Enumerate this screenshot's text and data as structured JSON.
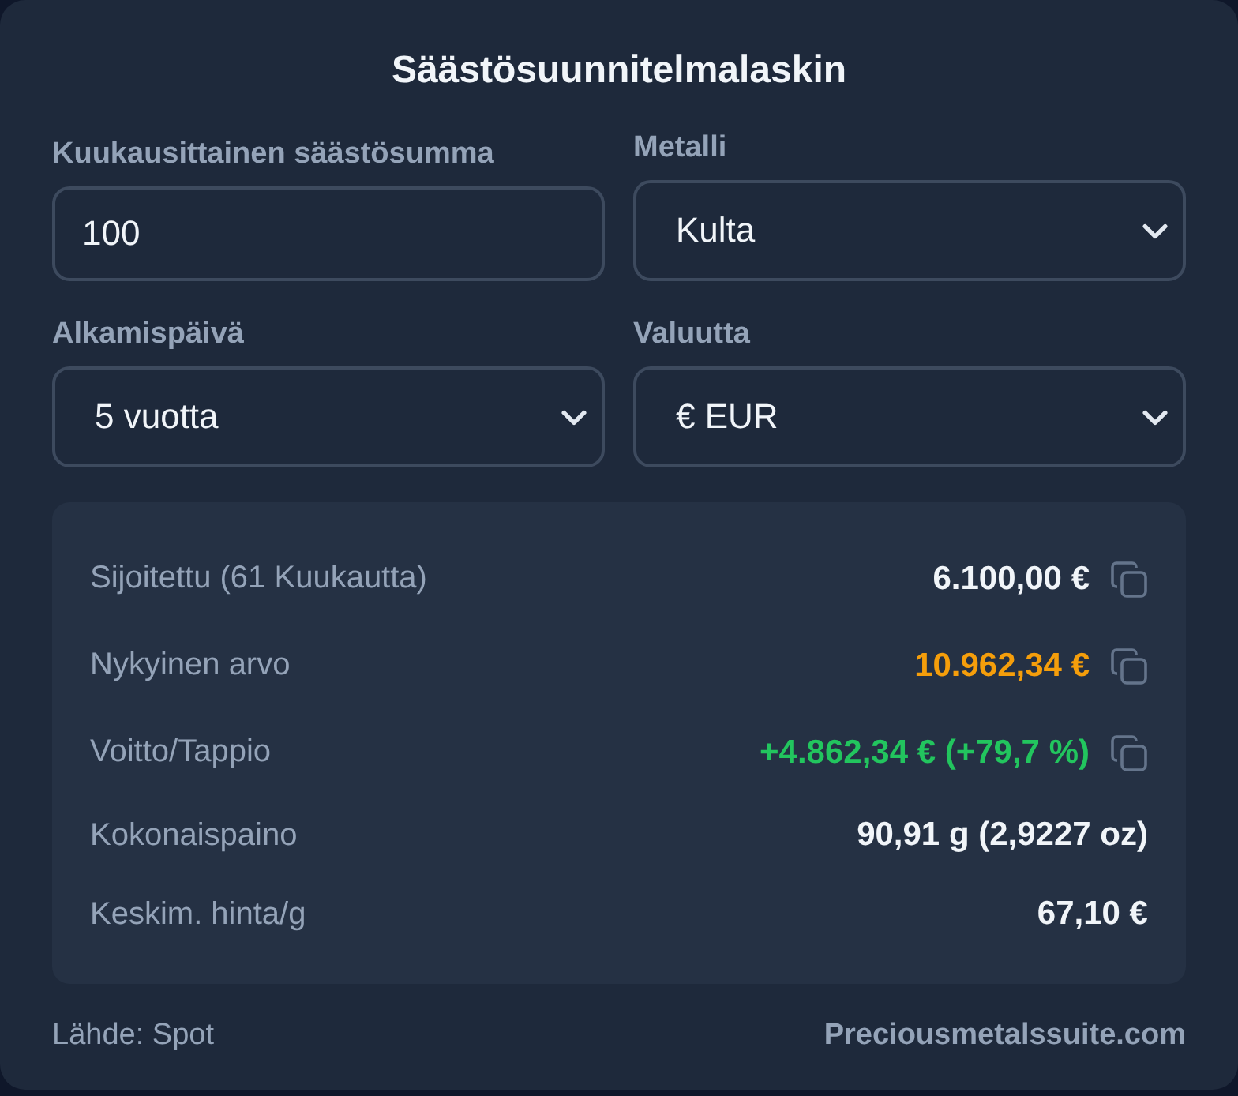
{
  "title": "Säästösuunnitelmalaskin",
  "fields": [
    {
      "kind": "input",
      "label": "Kuukausittainen säästösumma",
      "value": "100"
    },
    {
      "kind": "select",
      "label": "Metalli",
      "value": "Kulta"
    },
    {
      "kind": "select",
      "label": "Alkamispäivä",
      "value": "5 vuotta"
    },
    {
      "kind": "select",
      "label": "Valuutta",
      "value": "€ EUR"
    }
  ],
  "results": [
    {
      "label": "Sijoitettu (61 Kuukautta)",
      "value": "6.100,00 €",
      "color": "#f1f5f9",
      "copyable": true
    },
    {
      "label": "Nykyinen arvo",
      "value": "10.962,34 €",
      "color": "#f59e0b",
      "copyable": true
    },
    {
      "label": "Voitto/Tappio",
      "value": "+4.862,34 € (+79,7 %)",
      "color": "#22c55e",
      "copyable": true
    },
    {
      "label": "Kokonaispaino",
      "value": "90,91 g (2,9227 oz)",
      "color": "#f1f5f9",
      "copyable": false
    },
    {
      "label": "Keskim. hinta/g",
      "value": "67,10 €",
      "color": "#f1f5f9",
      "copyable": false
    }
  ],
  "footer": {
    "source": "Lähde: Spot",
    "link": "Preciousmetalssuite.com"
  }
}
